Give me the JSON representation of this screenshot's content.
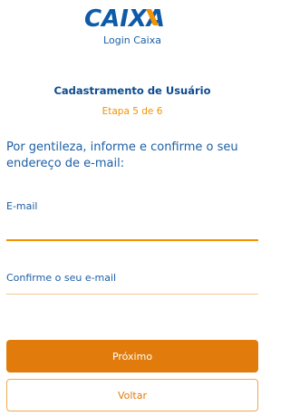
{
  "header": {
    "logo_text": "CAIXA",
    "subtitle": "Login Caixa"
  },
  "form": {
    "title": "Cadastramento de Usuário",
    "step": "Etapa 5 de 6",
    "instructions": "Por gentileza, informe e confirme o seu endereço de e-mail:",
    "email_label": "E-mail",
    "email_value": "",
    "confirm_email_label": "Confirme o seu e-mail",
    "confirm_email_value": ""
  },
  "buttons": {
    "next_label": "Próximo",
    "back_label": "Voltar"
  },
  "colors": {
    "brand_blue": "#1c5fa6",
    "brand_orange": "#f39200",
    "button_orange": "#e07b0c"
  }
}
